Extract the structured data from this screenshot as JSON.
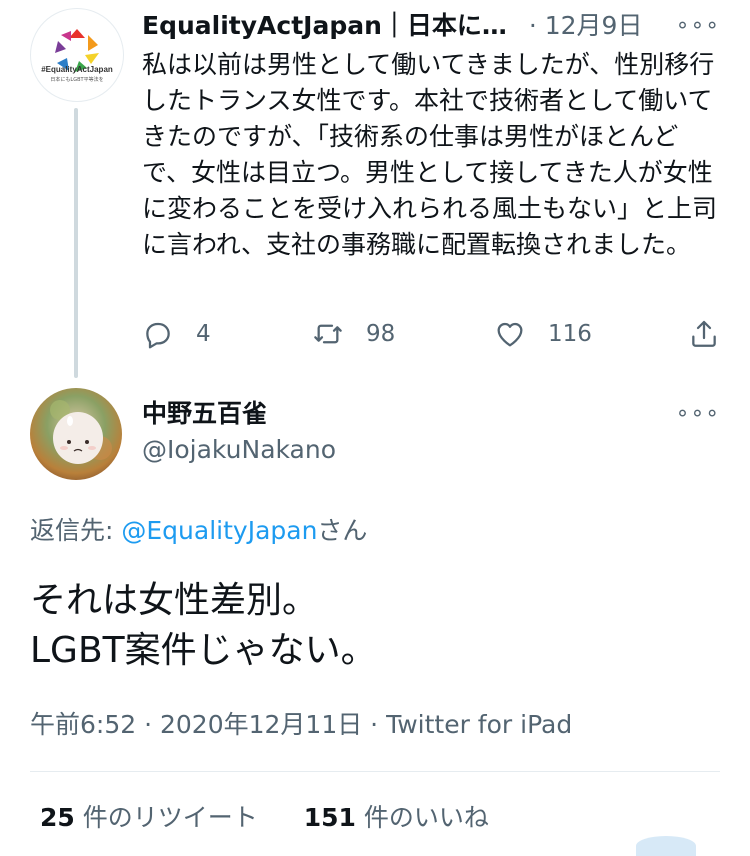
{
  "parent_tweet": {
    "display_name": "EqualityActJapan｜日本に…",
    "date": "· 12月9日",
    "avatar_text": "#EqualityActJapan",
    "avatar_subtext": "日本にもLGBT平等法を",
    "body": "私は以前は男性として働いてきましたが、性別移行したトランス女性です。本社で技術者として働いてきたのですが、「技術系の仕事は男性がほとんどで、女性は目立つ。男性として接してきた人が女性に変わることを受け入れられる風土もない」と上司に言われ、支社の事務職に配置転換されました。",
    "reply_count": "4",
    "retweet_count": "98",
    "like_count": "116"
  },
  "reply_tweet": {
    "display_name": "中野五百雀",
    "handle": "@IojakuNakano",
    "reply_to_label": "返信先: ",
    "reply_to_handle": "@EqualityJapan",
    "reply_to_suffix": "さん",
    "body_line1": "それは女性差別。",
    "body_line2": "LGBT案件じゃない。",
    "timestamp": "午前6:52 · 2020年12月11日 · Twitter for iPad"
  },
  "stats": {
    "retweets_count": "25",
    "retweets_label": " 件のリツイート",
    "likes_count": "151",
    "likes_label": " 件のいいね"
  },
  "colors": {
    "link": "#1d9bf0",
    "secondary_text": "#536471",
    "thread_line": "#cfd9de"
  }
}
